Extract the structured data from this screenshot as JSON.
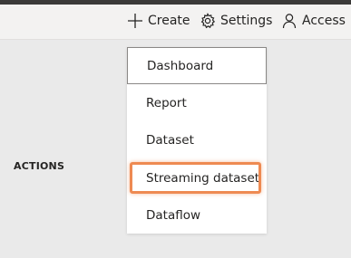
{
  "toolbar": {
    "create_label": "Create",
    "settings_label": "Settings",
    "access_label": "Access"
  },
  "icons": {
    "create": "plus-icon",
    "settings": "gear-icon",
    "access": "person-icon"
  },
  "section": {
    "actions_label": "ACTIONS"
  },
  "create_menu": {
    "items": [
      {
        "label": "Dashboard",
        "selected": true
      },
      {
        "label": "Report"
      },
      {
        "label": "Dataset"
      },
      {
        "label": "Streaming dataset",
        "highlighted": true
      },
      {
        "label": "Dataflow"
      }
    ]
  },
  "colors": {
    "highlight": "#ee8a52",
    "toolbar_bg": "#f3f2f1",
    "page_bg": "#eaeaea"
  }
}
